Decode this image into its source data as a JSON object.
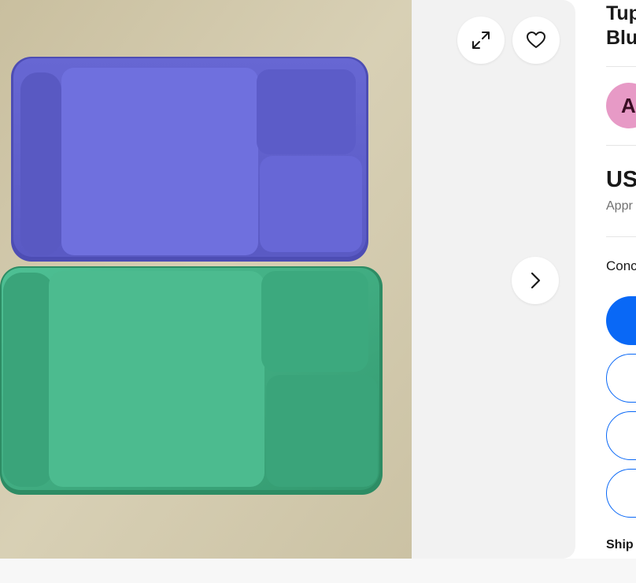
{
  "gallery": {
    "photo_alt": "Two divided plastic trays, one blue-purple and one green",
    "expand_icon": "expand-arrows-icon",
    "heart_icon": "heart-outline-icon",
    "next_icon": "chevron-right-icon"
  },
  "listing": {
    "title_line1": "Tup",
    "title_line2": "Blu",
    "seller_initial": "A",
    "price": "US",
    "approx_label": "Appr",
    "condition_label": "Conc",
    "shipping_label": "Ship"
  },
  "colors": {
    "primary_blue": "#0968f6",
    "avatar_pink": "#e79ac6",
    "tray_purple": "#6a6ad8",
    "tray_green": "#3fae83"
  }
}
